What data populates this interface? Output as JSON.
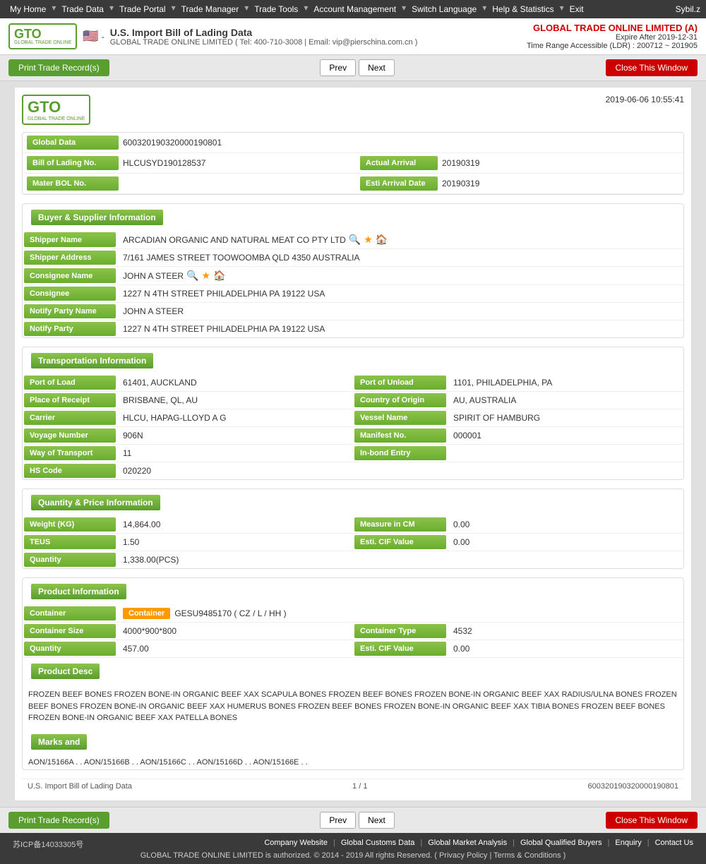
{
  "topnav": {
    "items": [
      "My Home",
      "Trade Data",
      "Trade Portal",
      "Trade Manager",
      "Trade Tools",
      "Account Management",
      "Switch Language",
      "Help & Statistics",
      "Exit"
    ],
    "user": "Sybil.z"
  },
  "header": {
    "title": "U.S. Import Bill of Lading Data",
    "contact": "GLOBAL TRADE ONLINE LIMITED ( Tel: 400-710-3008 | Email: vip@pierschina.com.cn )",
    "company": "GLOBAL TRADE ONLINE LIMITED (A)",
    "expire": "Expire After 2019-12-31",
    "time_range": "Time Range Accessible (LDR) : 200712 ~ 201905"
  },
  "toolbar": {
    "print_label": "Print Trade Record(s)",
    "prev_label": "Prev",
    "next_label": "Next",
    "close_label": "Close This Window"
  },
  "record": {
    "timestamp": "2019-06-06 10:55:41",
    "global_data_label": "Global Data",
    "global_data_value": "600320190320000190801",
    "bill_of_lading_no_label": "Bill of Lading No.",
    "bill_of_lading_no_value": "HLCUSYD190128537",
    "actual_arrival_label": "Actual Arrival",
    "actual_arrival_value": "20190319",
    "mater_bol_no_label": "Mater BOL No.",
    "esti_arrival_date_label": "Esti Arrival Date",
    "esti_arrival_date_value": "20190319"
  },
  "buyer_supplier": {
    "section_title": "Buyer & Supplier Information",
    "shipper_name_label": "Shipper Name",
    "shipper_name_value": "ARCADIAN ORGANIC AND NATURAL MEAT CO PTY LTD",
    "shipper_address_label": "Shipper Address",
    "shipper_address_value": "7/161 JAMES STREET TOOWOOMBA QLD 4350 AUSTRALIA",
    "consignee_name_label": "Consignee Name",
    "consignee_name_value": "JOHN A STEER",
    "consignee_label": "Consignee",
    "consignee_value": "1227 N 4TH STREET PHILADELPHIA PA 19122 USA",
    "notify_party_name_label": "Notify Party Name",
    "notify_party_name_value": "JOHN A STEER",
    "notify_party_label": "Notify Party",
    "notify_party_value": "1227 N 4TH STREET PHILADELPHIA PA 19122 USA"
  },
  "transportation": {
    "section_title": "Transportation Information",
    "port_of_load_label": "Port of Load",
    "port_of_load_value": "61401, AUCKLAND",
    "port_of_unload_label": "Port of Unload",
    "port_of_unload_value": "1101, PHILADELPHIA, PA",
    "place_of_receipt_label": "Place of Receipt",
    "place_of_receipt_value": "BRISBANE, QL, AU",
    "country_of_origin_label": "Country of Origin",
    "country_of_origin_value": "AU, AUSTRALIA",
    "carrier_label": "Carrier",
    "carrier_value": "HLCU, HAPAG-LLOYD A G",
    "vessel_name_label": "Vessel Name",
    "vessel_name_value": "SPIRIT OF HAMBURG",
    "voyage_number_label": "Voyage Number",
    "voyage_number_value": "906N",
    "manifest_no_label": "Manifest No.",
    "manifest_no_value": "000001",
    "way_of_transport_label": "Way of Transport",
    "way_of_transport_value": "11",
    "in_bond_entry_label": "In-bond Entry",
    "in_bond_entry_value": "",
    "hs_code_label": "HS Code",
    "hs_code_value": "020220"
  },
  "quantity_price": {
    "section_title": "Quantity & Price Information",
    "weight_label": "Weight (KG)",
    "weight_value": "14,864.00",
    "measure_in_cm_label": "Measure in CM",
    "measure_in_cm_value": "0.00",
    "teus_label": "TEUS",
    "teus_value": "1.50",
    "esti_cif_value_label": "Esti. CIF Value",
    "esti_cif_value_value": "0.00",
    "quantity_label": "Quantity",
    "quantity_value": "1,338.00(PCS)"
  },
  "product_info": {
    "section_title": "Product Information",
    "container_label": "Container",
    "container_badge": "Container",
    "container_value": "GESU9485170 ( CZ / L / HH )",
    "container_size_label": "Container Size",
    "container_size_value": "4000*900*800",
    "container_type_label": "Container Type",
    "container_type_value": "4532",
    "quantity_label": "Quantity",
    "quantity_value": "457.00",
    "esti_cif_value_label": "Esti. CIF Value",
    "esti_cif_value_value": "0.00",
    "product_desc_label": "Product Desc",
    "product_desc_text": "FROZEN BEEF BONES FROZEN BONE-IN ORGANIC BEEF XAX SCAPULA BONES FROZEN BEEF BONES FROZEN BONE-IN ORGANIC BEEF XAX RADIUS/ULNA BONES FROZEN BEEF BONES FROZEN BONE-IN ORGANIC BEEF XAX HUMERUS BONES FROZEN BEEF BONES FROZEN BONE-IN ORGANIC BEEF XAX TIBIA BONES FROZEN BEEF BONES FROZEN BONE-IN ORGANIC BEEF XAX PATELLA BONES",
    "marks_label": "Marks and",
    "marks_value": "AON/15166A . . AON/15166B . . AON/15166C . . AON/15166D . . AON/15166E . ."
  },
  "footer_record": {
    "data_type": "U.S. Import Bill of Lading Data",
    "page_info": "1 / 1",
    "record_id": "600320190320000190801"
  },
  "site_footer": {
    "icp": "苏ICP备14033305号",
    "links": [
      "Company Website",
      "Global Customs Data",
      "Global Market Analysis",
      "Global Qualified Buyers",
      "Enquiry",
      "Contact Us"
    ],
    "copyright": "GLOBAL TRADE ONLINE LIMITED is authorized. © 2014 - 2019 All rights Reserved.  (  Privacy Policy  |  Terms & Conditions  )"
  }
}
